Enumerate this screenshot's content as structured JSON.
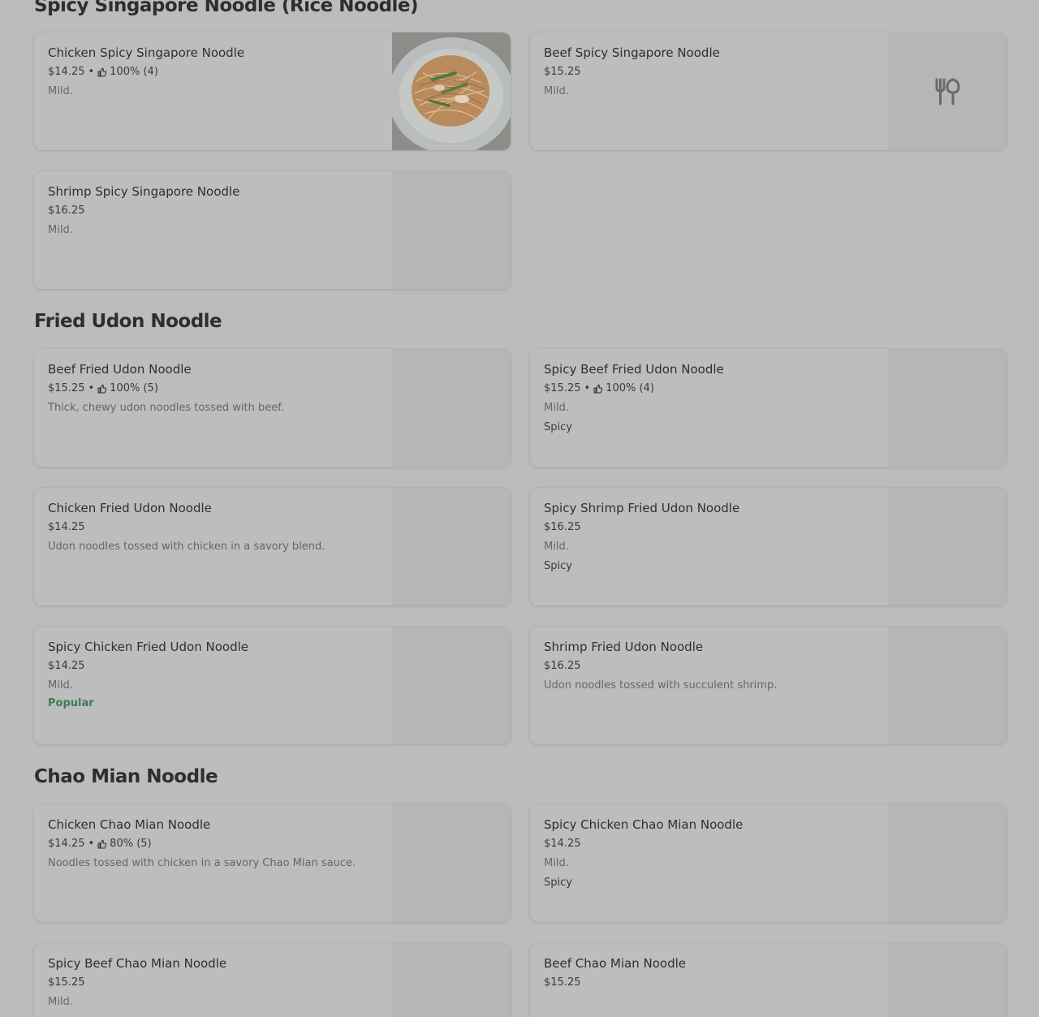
{
  "sections": [
    {
      "title": "Spicy Singapore Noodle (Rice Noodle)",
      "items": [
        {
          "name": "Chicken Spicy Singapore Noodle",
          "price": "$14.25",
          "rating": "100% (4)",
          "desc": "Mild.",
          "image": "noodle-photo"
        },
        {
          "name": "Beef Spicy Singapore Noodle",
          "price": "$15.25",
          "desc": "Mild.",
          "image": "fork-knife-icon"
        },
        {
          "name": "Shrimp Spicy Singapore Noodle",
          "price": "$16.25",
          "desc": "Mild."
        }
      ]
    },
    {
      "title": "Fried Udon Noodle",
      "items": [
        {
          "name": "Beef Fried Udon Noodle",
          "price": "$15.25",
          "rating": "100% (5)",
          "desc": "Thick, chewy udon noodles tossed with beef."
        },
        {
          "name": "Spicy Beef Fried Udon Noodle",
          "price": "$15.25",
          "rating": "100% (4)",
          "desc": "Mild.",
          "tag": "Spicy"
        },
        {
          "name": "Chicken Fried Udon Noodle",
          "price": "$14.25",
          "desc": "Udon noodles tossed with chicken in a savory blend."
        },
        {
          "name": "Spicy Shrimp Fried Udon Noodle",
          "price": "$16.25",
          "desc": "Mild.",
          "tag": "Spicy"
        },
        {
          "name": "Spicy Chicken Fried Udon Noodle",
          "price": "$14.25",
          "desc": "Mild.",
          "badge": "Popular"
        },
        {
          "name": "Shrimp Fried Udon Noodle",
          "price": "$16.25",
          "desc": "Udon noodles tossed with succulent shrimp."
        }
      ]
    },
    {
      "title": "Chao Mian Noodle",
      "items": [
        {
          "name": "Chicken Chao Mian Noodle",
          "price": "$14.25",
          "rating": "80% (5)",
          "desc": "Noodles tossed with chicken in a savory Chao Mian sauce."
        },
        {
          "name": "Spicy Chicken Chao Mian Noodle",
          "price": "$14.25",
          "desc": "Mild.",
          "tag": "Spicy"
        },
        {
          "name": "Spicy Beef Chao Mian Noodle",
          "price": "$15.25",
          "desc": "Mild."
        },
        {
          "name": "Beef Chao Mian Noodle",
          "price": "$15.25"
        }
      ]
    }
  ],
  "rating_icon": "thumbs-up-icon",
  "colors": {
    "background": "#bcbcbc",
    "popular": "#3f7a56"
  }
}
